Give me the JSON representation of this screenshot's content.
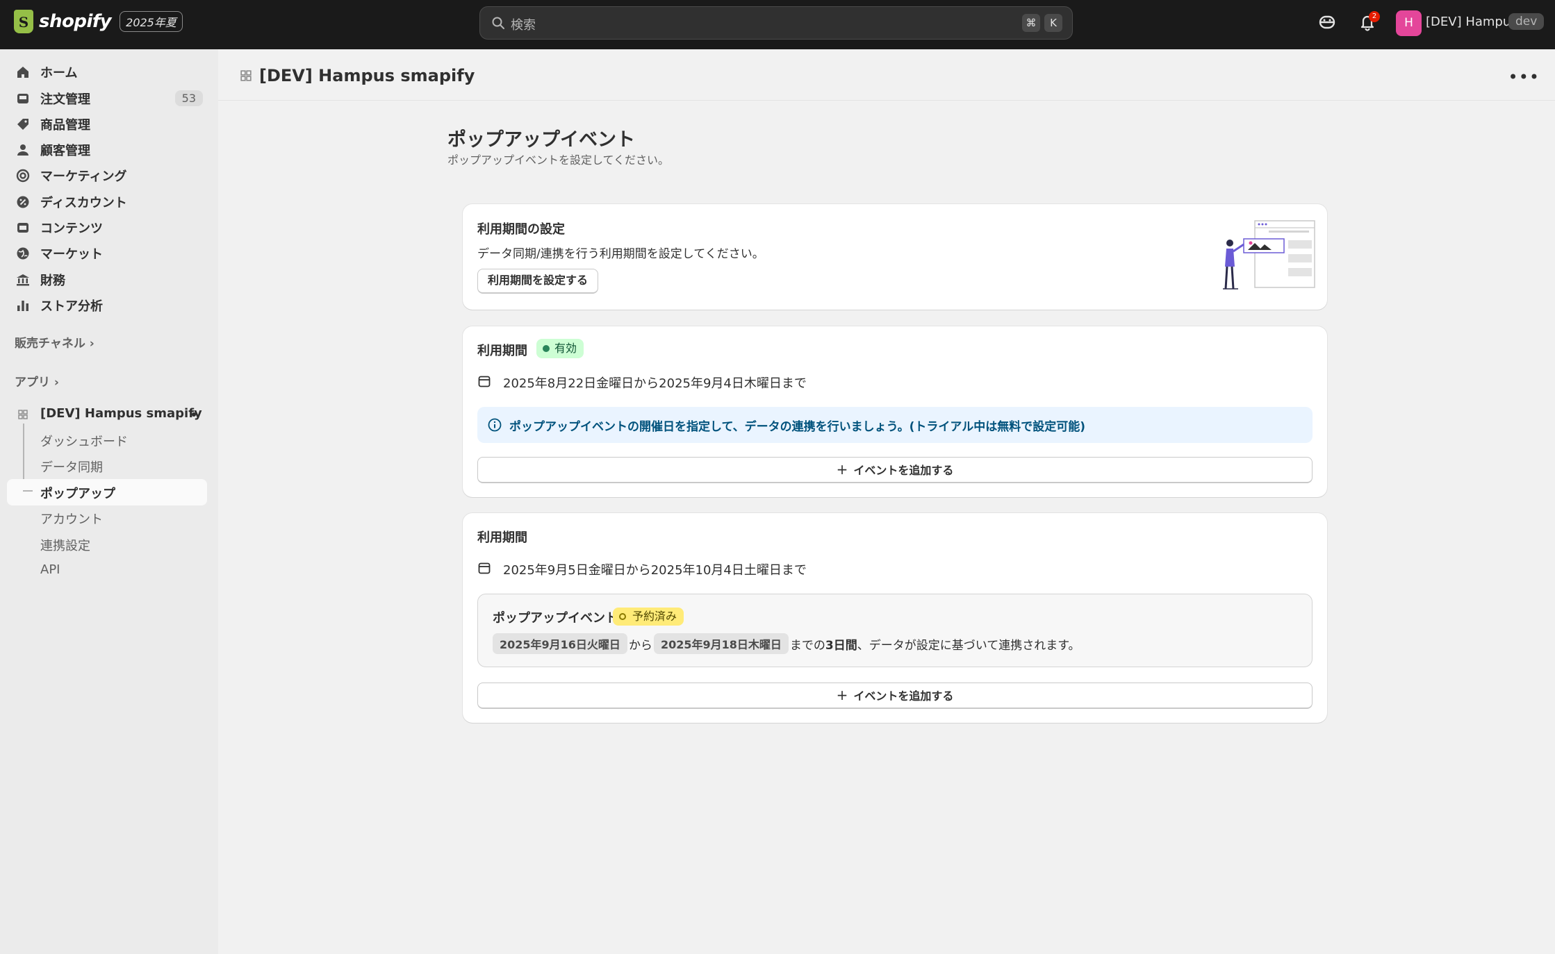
{
  "topbar": {
    "logo_text": "shopify",
    "edition": "2025年夏",
    "search_placeholder": "検索",
    "shortcut_cmd": "⌘",
    "shortcut_key": "K",
    "notification_count": "2",
    "avatar_initial": "H",
    "username": "[DEV] Hampus",
    "env_badge": "dev"
  },
  "sidebar": {
    "items": [
      {
        "label": "ホーム",
        "icon": "home-icon"
      },
      {
        "label": "注文管理",
        "icon": "inbox-icon",
        "count": "53"
      },
      {
        "label": "商品管理",
        "icon": "tag-icon"
      },
      {
        "label": "顧客管理",
        "icon": "person-icon"
      },
      {
        "label": "マーケティング",
        "icon": "target-icon"
      },
      {
        "label": "ディスカウント",
        "icon": "discount-icon"
      },
      {
        "label": "コンテンツ",
        "icon": "image-icon"
      },
      {
        "label": "マーケット",
        "icon": "globe-icon"
      },
      {
        "label": "財務",
        "icon": "bank-icon"
      },
      {
        "label": "ストア分析",
        "icon": "chart-icon"
      }
    ],
    "sales_channels": "販売チャネル",
    "apps": "アプリ",
    "app_name": "[DEV] Hampus smapify",
    "sub_items": [
      "ダッシュボード",
      "データ同期",
      "ポップアップ",
      "アカウント",
      "連携設定",
      "API"
    ]
  },
  "page": {
    "app_title": "[DEV] Hampus smapify",
    "heading": "ポップアップイベント",
    "subheading": "ポップアップイベントを設定してください。"
  },
  "card_setup": {
    "title": "利用期間の設定",
    "description": "データ同期/連携を行う利用期間を設定してください。",
    "button": "利用期間を設定する"
  },
  "card_period1": {
    "title": "利用期間",
    "badge": "有効",
    "date_range": "2025年8月22日金曜日から2025年9月4日木曜日まで",
    "banner": "ポップアップイベントの開催日を指定して、データの連携を行いましょう。(トライアル中は無料で設定可能)",
    "add_button": "イベントを追加する"
  },
  "card_period2": {
    "title": "利用期間",
    "date_range": "2025年9月5日金曜日から2025年10月4日土曜日まで",
    "event": {
      "title": "ポップアップイベント",
      "badge": "予約済み",
      "start": "2025年9月16日火曜日",
      "from": "から",
      "end": "2025年9月18日木曜日",
      "until": "までの",
      "duration": "3日間",
      "suffix": "、データが設定に基づいて連携されます。"
    },
    "add_button": "イベントを追加する"
  },
  "colors": {
    "topbar": "#1a1a1a",
    "success": "#cdfed4",
    "attention": "#ffeb78",
    "info": "#eaf4ff"
  }
}
